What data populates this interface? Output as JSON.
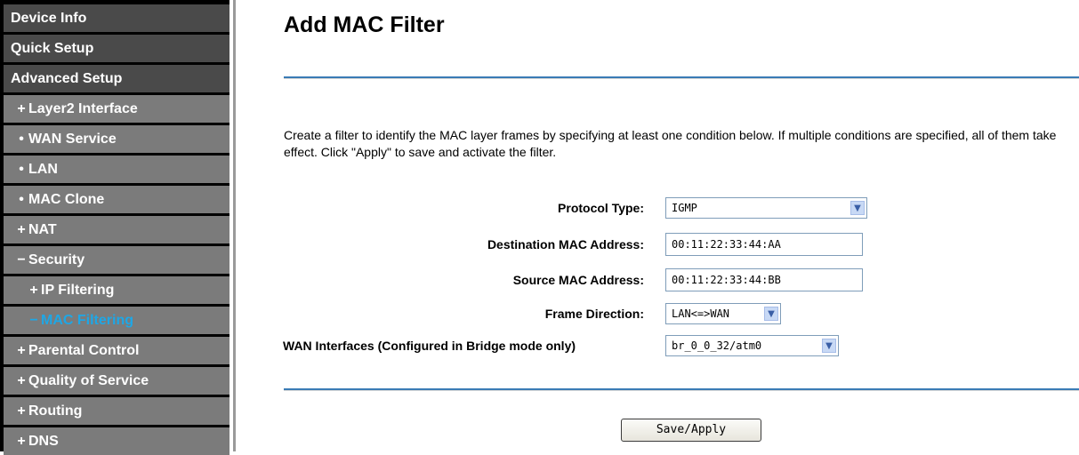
{
  "sidebar": {
    "items": [
      {
        "label": "Device Info",
        "prefix": ""
      },
      {
        "label": "Quick Setup",
        "prefix": ""
      },
      {
        "label": "Advanced Setup",
        "prefix": ""
      },
      {
        "label": "Layer2 Interface",
        "prefix": "+"
      },
      {
        "label": "WAN Service",
        "prefix": "•"
      },
      {
        "label": "LAN",
        "prefix": "•"
      },
      {
        "label": "MAC Clone",
        "prefix": "•"
      },
      {
        "label": "NAT",
        "prefix": "+"
      },
      {
        "label": "Security",
        "prefix": "−"
      },
      {
        "label": "IP Filtering",
        "prefix": "+"
      },
      {
        "label": "MAC Filtering",
        "prefix": "−"
      },
      {
        "label": "Parental Control",
        "prefix": "+"
      },
      {
        "label": "Quality of Service",
        "prefix": "+"
      },
      {
        "label": "Routing",
        "prefix": "+"
      },
      {
        "label": "DNS",
        "prefix": "+"
      }
    ]
  },
  "page": {
    "title": "Add MAC Filter",
    "description": "Create a filter to identify the MAC layer frames by specifying at least one condition below. If multiple conditions are specified, all of them take effect. Click \"Apply\" to save and activate the filter."
  },
  "form": {
    "protocol_type": {
      "label": "Protocol Type:",
      "value": "IGMP"
    },
    "destination_mac": {
      "label": "Destination MAC Address:",
      "value": "00:11:22:33:44:AA"
    },
    "source_mac": {
      "label": "Source MAC Address:",
      "value": "00:11:22:33:44:BB"
    },
    "frame_direction": {
      "label": "Frame Direction:",
      "value": "LAN<=>WAN"
    },
    "wan_interfaces": {
      "label": "WAN Interfaces (Configured in Bridge mode only)",
      "value": "br_0_0_32/atm0"
    }
  },
  "actions": {
    "save_apply_label": "Save/Apply"
  }
}
